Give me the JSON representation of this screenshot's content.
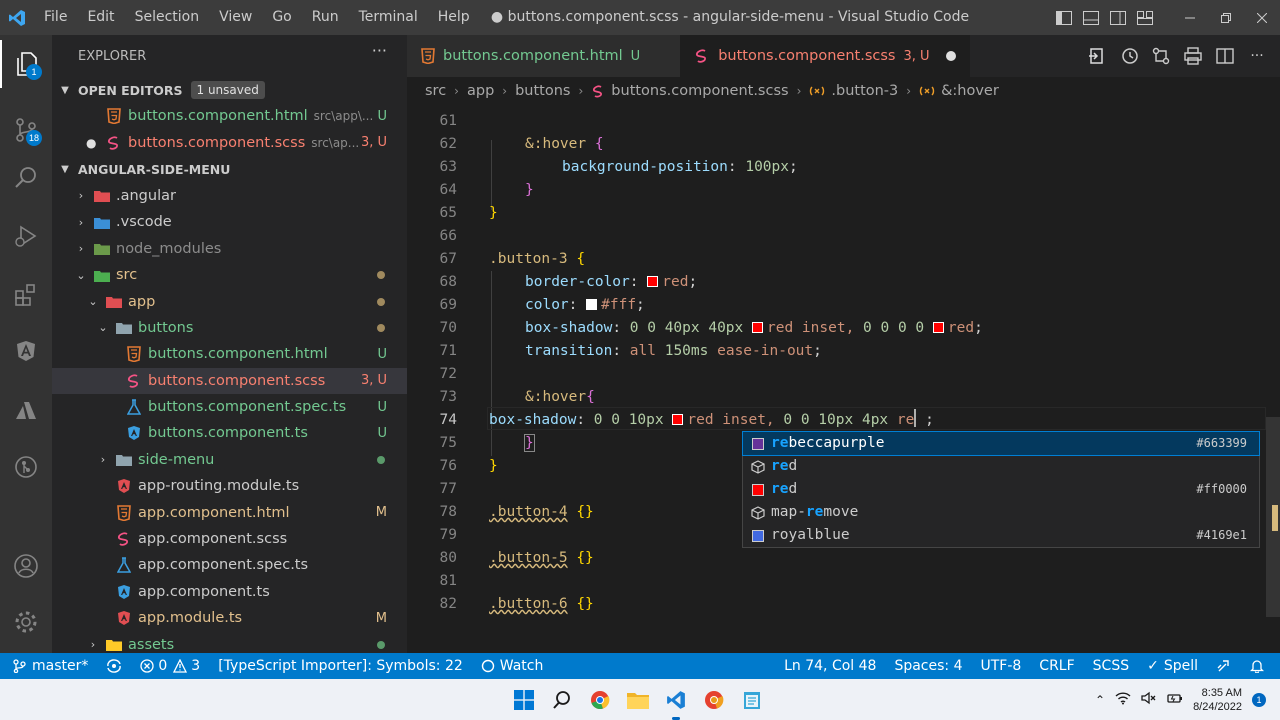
{
  "window": {
    "title": "● buttons.component.scss - angular-side-menu - Visual Studio Code",
    "menu": [
      "File",
      "Edit",
      "Selection",
      "View",
      "Go",
      "Run",
      "Terminal",
      "Help"
    ]
  },
  "activity_bar": {
    "explorer_badge": "1",
    "scm_badge": "18"
  },
  "sidebar": {
    "title": "EXPLORER",
    "more": "···",
    "open_editors": {
      "label": "OPEN EDITORS",
      "badge": "1 unsaved",
      "items": [
        {
          "name": "buttons.component.html",
          "path": "src\\app\\...",
          "status": "U"
        },
        {
          "name": "buttons.component.scss",
          "path": "src\\ap...",
          "status": "3, U"
        }
      ]
    },
    "project": {
      "label": "ANGULAR-SIDE-MENU",
      "tree": [
        {
          "name": ".angular"
        },
        {
          "name": ".vscode"
        },
        {
          "name": "node_modules"
        },
        {
          "name": "src"
        },
        {
          "name": "app"
        },
        {
          "name": "buttons"
        },
        {
          "name": "buttons.component.html",
          "status": "U"
        },
        {
          "name": "buttons.component.scss",
          "status": "3, U"
        },
        {
          "name": "buttons.component.spec.ts",
          "status": "U"
        },
        {
          "name": "buttons.component.ts",
          "status": "U"
        },
        {
          "name": "side-menu"
        },
        {
          "name": "app-routing.module.ts"
        },
        {
          "name": "app.component.html",
          "status": "M"
        },
        {
          "name": "app.component.scss"
        },
        {
          "name": "app.component.spec.ts"
        },
        {
          "name": "app.component.ts"
        },
        {
          "name": "app.module.ts",
          "status": "M"
        },
        {
          "name": "assets"
        }
      ]
    }
  },
  "tabs": [
    {
      "label": "buttons.component.html",
      "status": "U"
    },
    {
      "label": "buttons.component.scss",
      "status": "3, U"
    }
  ],
  "breadcrumb": [
    "src",
    "app",
    "buttons",
    "buttons.component.scss",
    ".button-3",
    "&:hover"
  ],
  "code": {
    "line_numbers": [
      "61",
      "62",
      "63",
      "64",
      "65",
      "66",
      "67",
      "68",
      "69",
      "70",
      "71",
      "72",
      "73",
      "74",
      "75",
      "76",
      "77",
      "78",
      "79",
      "80",
      "81",
      "82"
    ],
    "l62_sel": "&:hover",
    "l63_prop": "background-position",
    "l63_val": "100px",
    "l67_sel": ".button-3",
    "l68_prop": "border-color",
    "l68_val": "red",
    "l69_prop": "color",
    "l69_val": "#fff",
    "l70_prop": "box-shadow",
    "l70_a": "0 0 40px 40px",
    "l70_b": "red inset, ",
    "l70_c": "0 0 0 0",
    "l70_d": "red",
    "l71_prop": "transition",
    "l71_a": "all",
    "l71_b": "150ms",
    "l71_c": "ease-in-out",
    "l73_sel": "&:hover",
    "l74_prop": "box-shadow",
    "l74_a": "0 0 10px",
    "l74_b": "red inset, ",
    "l74_c": "0 0 10px 4px",
    "l74_d": "re",
    "l78_sel": ".button-4",
    "l80_sel": ".button-5",
    "l82_sel": ".button-6",
    "empty_rule": "{}"
  },
  "suggestions": [
    {
      "hl": "re",
      "rest": "beccapurple",
      "detail": "#663399",
      "color": "#663399",
      "kind": "color"
    },
    {
      "hl": "re",
      "rest": "d",
      "detail": "",
      "color": "",
      "kind": "keyword"
    },
    {
      "hl": "re",
      "rest": "d",
      "detail": "#ff0000",
      "color": "#ff0000",
      "kind": "color"
    },
    {
      "hl": "map-",
      "rest": "remove",
      "detail": "",
      "color": "",
      "kind": "function",
      "pre": "map-",
      "mid": "re",
      "post": "move"
    },
    {
      "hl": "",
      "rest": "royalblue",
      "detail": "#4169e1",
      "color": "#4169e1",
      "kind": "color"
    }
  ],
  "status_bar": {
    "branch": "master*",
    "errors": "0",
    "warnings": "3",
    "importer": "[TypeScript Importer]: Symbols: 22",
    "watch": "Watch",
    "position": "Ln 74, Col 48",
    "spaces": "Spaces: 4",
    "encoding": "UTF-8",
    "eol": "CRLF",
    "language": "SCSS",
    "spell": "Spell"
  },
  "taskbar": {
    "time": "8:35 AM",
    "date": "8/24/2022",
    "notifications": "1"
  },
  "colors": {
    "accent": "#007acc",
    "untracked": "#73c991",
    "modified": "#e2c08d",
    "error": "#f88070"
  }
}
